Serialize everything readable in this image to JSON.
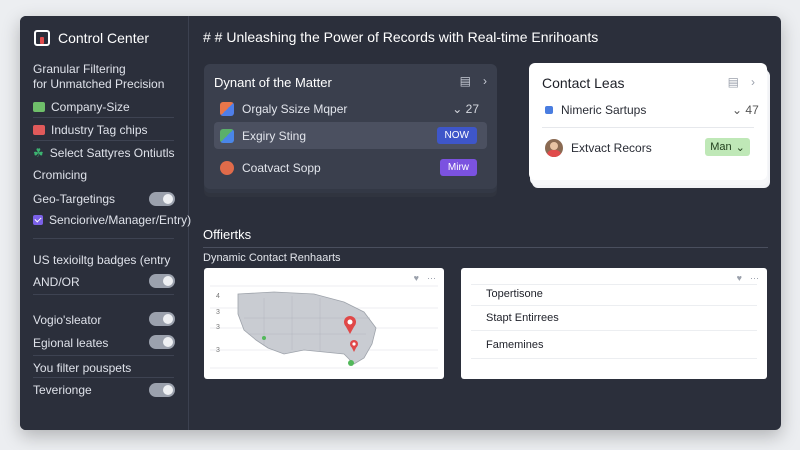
{
  "app": {
    "title": "Control Center"
  },
  "sidebar": {
    "intro_line1": "Granular Filtering",
    "intro_line2": "for Unmatched Precision",
    "items": [
      {
        "label": "Company-Size",
        "color": "#6fbf6a"
      },
      {
        "label": "Industry Tag chips",
        "color": "#e05a5a"
      },
      {
        "label": "Select Sattyres Ontiutls",
        "color": "#3cb371"
      }
    ],
    "cromicing": "Cromicing",
    "geo_label": "Geo-Targetings",
    "seniority_label": "Senciorive/Manager/Entry)",
    "badges_label": "US texioiltg badges (entry",
    "andor_label": "AND/OR",
    "vogio_label": "Vogio'sleator",
    "egional_label": "Egional leates",
    "filter_label": "You filter pouspets",
    "teverionge_label": "Teverionge"
  },
  "main": {
    "title": "# # Unleashing the Power of Records with Real-time Enrihoants",
    "card_a": {
      "title": "Dynant of the Matter",
      "rows": [
        {
          "label": "Orgaly Ssize Mqper",
          "value": "⌄ 27"
        },
        {
          "label": "Exgiry Sting",
          "badge": "NOW",
          "badge_color": "#3e56c9"
        },
        {
          "label": "Coatvact Sopp",
          "badge": "Mirw",
          "badge_color": "#7b52e0"
        }
      ]
    },
    "card_b": {
      "title": "Contact Leas",
      "row1_label": "Nimeric Sartups",
      "row1_value": "⌄ 47",
      "row2_label": "Extvact Recors",
      "row2_button": "Man"
    },
    "section": {
      "title": "Offiertks",
      "subtitle": "Dynamic Contact Renhaarts"
    },
    "map_card": {
      "y_ticks": [
        "4",
        "3",
        "3",
        "3"
      ]
    },
    "list_card": {
      "items": [
        "Topertisone",
        "Stapt Entirrees",
        "Famemines"
      ]
    }
  }
}
